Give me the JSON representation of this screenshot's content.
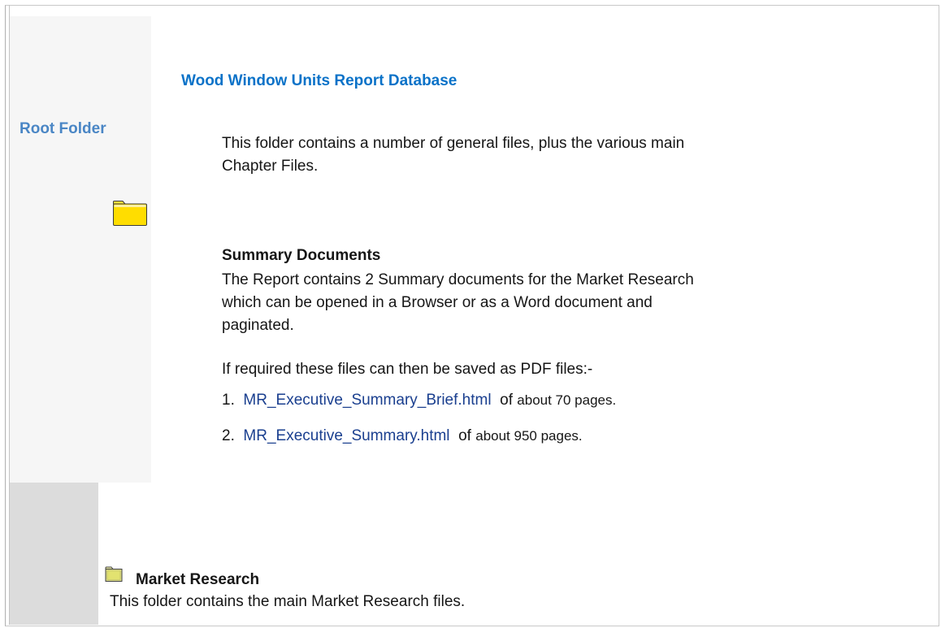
{
  "sidebar": {
    "root_folder_label": "Root Folder"
  },
  "main": {
    "title": "Wood Window Units Report Database",
    "intro": "This folder contains a number of general files, plus the various main Chapter Files.",
    "summary_heading": "Summary Documents",
    "summary_text": "The Report contains 2 Summary documents for the Market Research which can be opened in a Browser or as a Word document and paginated.",
    "pdf_note": "If required these files can then be saved as PDF files:-",
    "documents": [
      {
        "number": "1.",
        "link": "MR_Executive_Summary_Brief.html",
        "of_text": "of",
        "pages_text": "about 70 pages."
      },
      {
        "number": "2.",
        "link": "MR_Executive_Summary.html",
        "of_text": "of",
        "pages_text": "about 950 pages."
      }
    ]
  },
  "market_research": {
    "heading": "Market Research",
    "description": "This folder contains the main Market Research files."
  },
  "colors": {
    "title": "#0a72c8",
    "root_folder": "#4a86c5",
    "link": "#1a3f8f",
    "folder_yellow": "#ffdd00",
    "folder_khaki": "#dede88"
  }
}
